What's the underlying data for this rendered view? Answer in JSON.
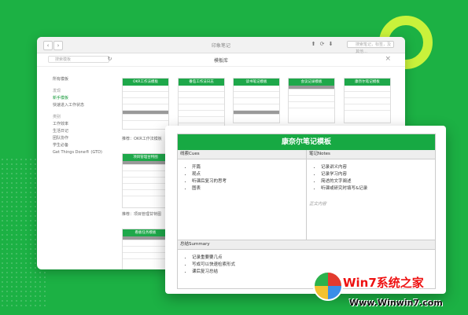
{
  "window": {
    "title": "印象笔记",
    "search_placeholder": "搜索笔记，标签，及其他…"
  },
  "toolbar": {
    "search_placeholder": "搜索模板",
    "title": "模板库"
  },
  "sidebar": {
    "items": [
      "所有模板"
    ],
    "section1": "发现",
    "section1_items": [
      "新手模板",
      "快速进入工作状态"
    ],
    "section2": "类别",
    "section2_items": [
      "工作效率",
      "生活日记",
      "团队协作",
      "学生必备",
      "Get Things Done® (GTD)"
    ]
  },
  "cards": [
    {
      "title": "OKR工作法模板"
    },
    {
      "title": "番茄工作法日志"
    },
    {
      "title": "读书笔记模板"
    },
    {
      "title": "会议记录模板"
    },
    {
      "title": "康奈尔笔记模板"
    },
    {
      "title": "项目管理甘特图"
    },
    {
      "title": "看板任务模板"
    }
  ],
  "captions": {
    "okr": "推荐：OKR工作法模板",
    "project": "推荐：项目管理甘特图"
  },
  "overlay": {
    "title": "康奈尔笔记模板",
    "left_header": "线索Cues",
    "left_items": [
      "开篇",
      "观点",
      "听课后复习的思考",
      "图表"
    ],
    "right_header": "笔记Notes",
    "right_items": [
      "记录讲义内容",
      "记录学习内容",
      "简述的文字阐述",
      "听课或研究时填写&记录"
    ],
    "right_note": "正文内容",
    "summary_header": "总结Summary",
    "summary_items": [
      "记录重要要几点",
      "写成可以快速检索形式",
      "课后复习总结"
    ]
  },
  "watermark": {
    "brand": "Win7系统之家",
    "url": "Www.Winwin7.com"
  }
}
